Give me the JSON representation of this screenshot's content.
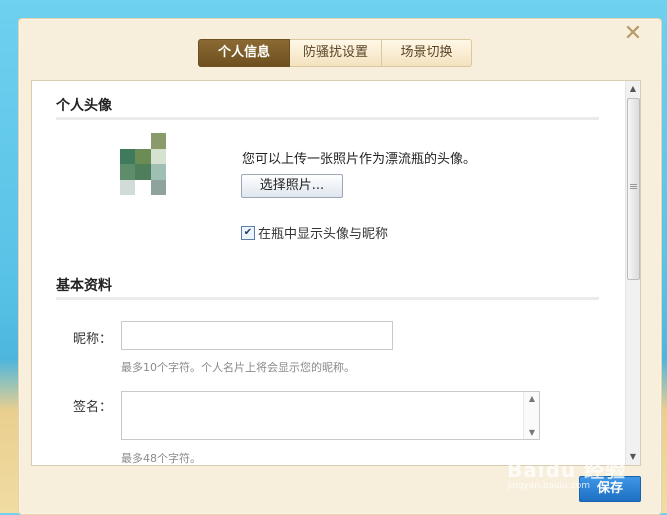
{
  "dialog": {
    "close_icon": "close-icon",
    "tabs": [
      {
        "label": "个人信息",
        "active": true
      },
      {
        "label": "防骚扰设置",
        "active": false
      },
      {
        "label": "场景切换",
        "active": false
      }
    ]
  },
  "avatar_section": {
    "title": "个人头像",
    "upload_text": "您可以上传一张照片作为漂流瓶的头像。",
    "choose_button": "选择照片...",
    "show_avatar_checkbox": {
      "label": "在瓶中显示头像与昵称",
      "checked": true
    }
  },
  "profile_section": {
    "title": "基本资料",
    "nickname": {
      "label": "昵称：",
      "value": "",
      "hint": "最多10个字符。个人名片上将会显示您的昵称。"
    },
    "signature": {
      "label": "签名：",
      "value": "",
      "hint": "最多48个字符。"
    }
  },
  "footer": {
    "save_button": "保存"
  },
  "watermark": {
    "text": "Baidu 经验",
    "subtext": "jingyan.baidu.com"
  },
  "colors": {
    "active_tab": "#7a5a28",
    "save_button": "#2a80d6",
    "dialog_bg": "#f8eedc"
  }
}
